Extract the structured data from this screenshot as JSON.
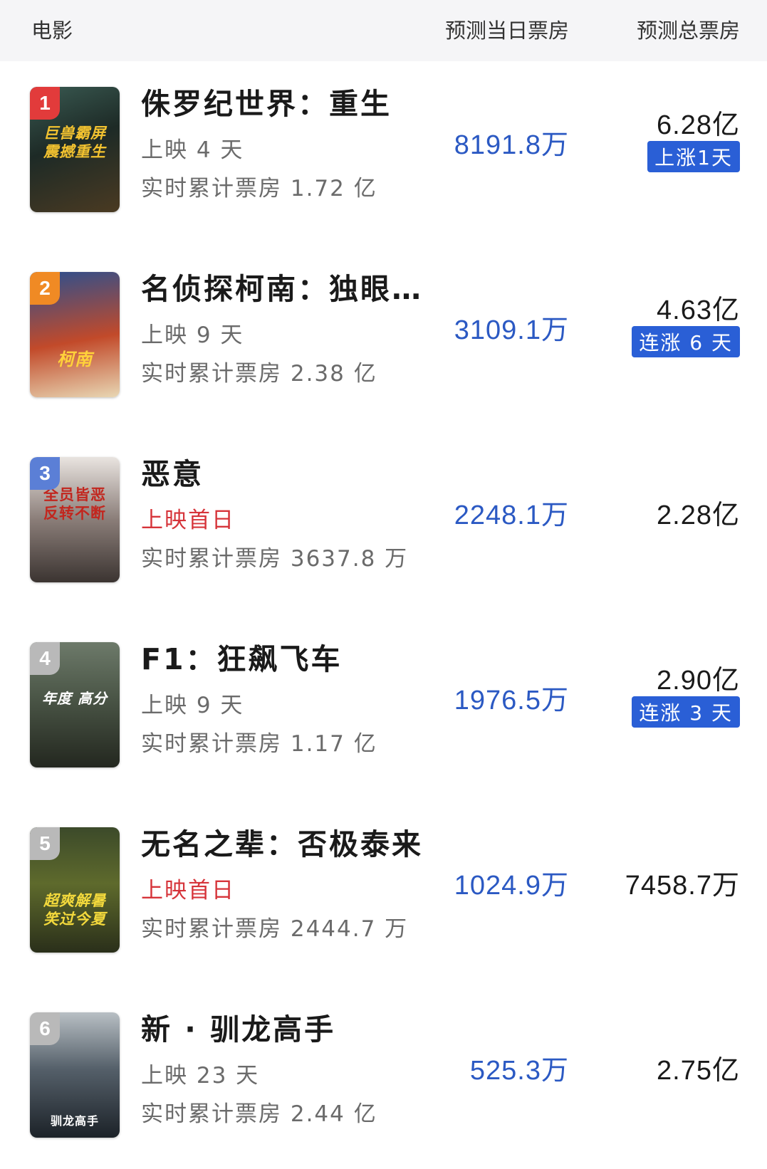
{
  "header": {
    "movie": "电影",
    "today_forecast": "预测当日票房",
    "total_forecast": "预测总票房"
  },
  "colors": {
    "today_value": "#2b59c3",
    "badge_bg": "#2a5fd6",
    "first_day_text": "#d6343a",
    "rank_1": "#e23b3b",
    "rank_2": "#f08a24",
    "rank_3": "#5b7fd6",
    "rank_other": "#b9b9b9"
  },
  "movies": [
    {
      "rank": "1",
      "title": "侏罗纪世界：重生",
      "days": "上映 4 天",
      "cumulative": "实时累计票房 1.72 亿",
      "today": "8191.8万",
      "total": "6.28亿",
      "trend": "上涨1天",
      "poster_text": "巨兽霸屏\n震撼重生"
    },
    {
      "rank": "2",
      "title": "名侦探柯南：独眼…",
      "days": "上映 9 天",
      "cumulative": "实时累计票房 2.38 亿",
      "today": "3109.1万",
      "total": "4.63亿",
      "trend": "连涨 6 天",
      "poster_text": "柯南"
    },
    {
      "rank": "3",
      "title": "恶意",
      "days": "上映首日",
      "cumulative": "实时累计票房 3637.8 万",
      "today": "2248.1万",
      "total": "2.28亿",
      "trend": "",
      "poster_text": "全员皆恶\n反转不断"
    },
    {
      "rank": "4",
      "title": "F1：狂飙飞车",
      "days": "上映 9 天",
      "cumulative": "实时累计票房 1.17 亿",
      "today": "1976.5万",
      "total": "2.90亿",
      "trend": "连涨 3 天",
      "poster_text": "年度 高分"
    },
    {
      "rank": "5",
      "title": "无名之辈：否极泰来",
      "days": "上映首日",
      "cumulative": "实时累计票房 2444.7 万",
      "today": "1024.9万",
      "total": "7458.7万",
      "trend": "",
      "poster_text": "超爽解暑\n笑过今夏"
    },
    {
      "rank": "6",
      "title": "新 · 驯龙高手",
      "days": "上映 23 天",
      "cumulative": "实时累计票房 2.44 亿",
      "today": "525.3万",
      "total": "2.75亿",
      "trend": "",
      "poster_text": "驯龙高手"
    }
  ]
}
